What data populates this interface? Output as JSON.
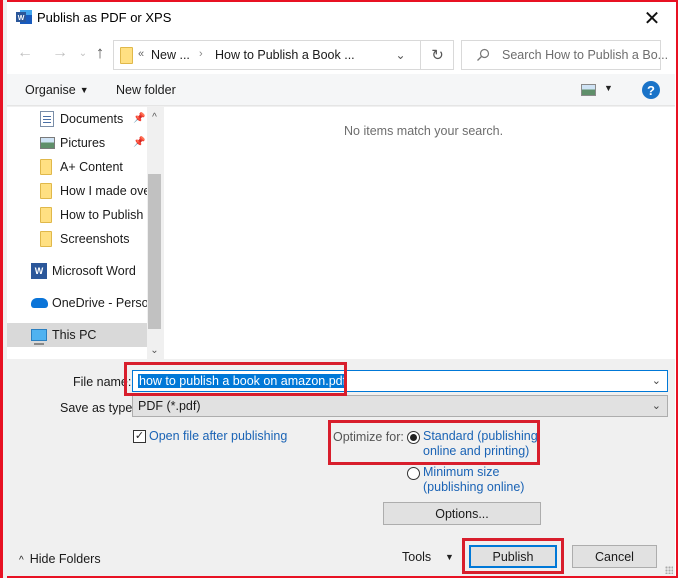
{
  "window": {
    "title": "Publish as PDF or XPS",
    "close_glyph": "✕"
  },
  "nav": {
    "back_glyph": "←",
    "forward_glyph": "→",
    "recent_glyph": "⌄",
    "up_glyph": "↑",
    "address": {
      "overflow_glyph": "«",
      "crumbs": [
        "New ...",
        "How to Publish a Book ..."
      ],
      "separator_glyph": "›",
      "dropdown_glyph": "⌄",
      "refresh_glyph": "↻"
    },
    "search": {
      "placeholder": "Search How to Publish a Bo..."
    }
  },
  "toolbar": {
    "organise_label": "Organise",
    "caret_glyph": "▼",
    "new_folder_label": "New folder",
    "help_glyph": "?"
  },
  "sidebar": {
    "items": [
      {
        "label": "Documents",
        "icon": "documents-icon",
        "pinned": true
      },
      {
        "label": "Pictures",
        "icon": "pictures-icon",
        "pinned": true
      },
      {
        "label": "A+ Content",
        "icon": "folder-icon"
      },
      {
        "label": "How I made over",
        "icon": "folder-icon"
      },
      {
        "label": "How to Publish a",
        "icon": "folder-icon"
      },
      {
        "label": "Screenshots",
        "icon": "folder-icon"
      },
      {
        "label": "Microsoft Word",
        "icon": "word-icon"
      },
      {
        "label": "OneDrive - Personal",
        "icon": "onedrive-icon"
      },
      {
        "label": "This PC",
        "icon": "computer-icon",
        "selected": true
      }
    ],
    "pin_glyph": "📌",
    "scroll_up_glyph": "^",
    "scroll_down_glyph": "⌄"
  },
  "main": {
    "empty_message": "No items match your search."
  },
  "form": {
    "file_name_label": "File name:",
    "file_name_value": "how to publish a book on amazon.pdf",
    "save_as_type_label": "Save as type:",
    "save_as_type_value": "PDF (*.pdf)",
    "dropdown_glyph": "⌄",
    "open_after_label": "Open file after publishing",
    "open_after_checked": true,
    "check_glyph": "✓",
    "optimize_label": "Optimize for:",
    "optimize_options": [
      {
        "line1": "Standard (publishing",
        "line2": "online and printing)",
        "checked": true
      },
      {
        "line1": "Minimum size",
        "line2": "(publishing online)",
        "checked": false
      }
    ],
    "options_button": "Options..."
  },
  "footer": {
    "hide_folders_label": "Hide Folders",
    "hide_glyph": "^",
    "tools_label": "Tools",
    "tools_caret": "▼",
    "publish_button": "Publish",
    "cancel_button": "Cancel"
  },
  "colors": {
    "highlight_red": "#d81e2c",
    "accent_blue": "#0078d7",
    "link_blue": "#1a63b5"
  }
}
